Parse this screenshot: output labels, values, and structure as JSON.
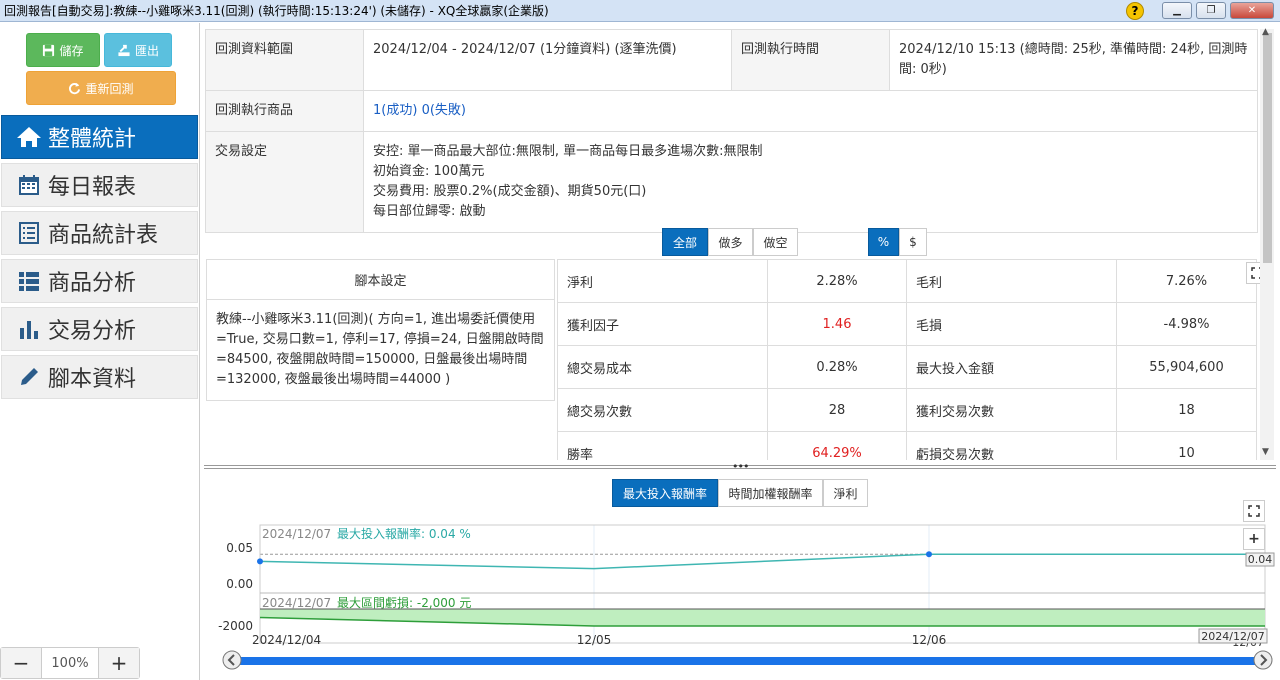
{
  "window": {
    "title": "回測報告[自動交易]:教練--小雞啄米3.11(回測) (執行時間:15:13:24') (未儲存) - XQ全球贏家(企業版)",
    "help": "?",
    "min": "▁",
    "restore": "❐",
    "close": "✕"
  },
  "sidebar": {
    "save_label": "儲存",
    "export_label": "匯出",
    "rerun_label": "重新回測",
    "items": [
      {
        "label": "整體統計",
        "icon": "home-icon"
      },
      {
        "label": "每日報表",
        "icon": "calendar-icon"
      },
      {
        "label": "商品統計表",
        "icon": "list-icon"
      },
      {
        "label": "商品分析",
        "icon": "list-bullet-icon"
      },
      {
        "label": "交易分析",
        "icon": "bar-chart-icon"
      },
      {
        "label": "腳本資料",
        "icon": "pencil-icon"
      }
    ],
    "zoom": {
      "minus": "−",
      "value": "100%",
      "plus": "+"
    }
  },
  "info": {
    "range_label": "回測資料範圍",
    "range_value": "2024/12/04 - 2024/12/07 (1分鐘資料) (逐筆洗價)",
    "exec_label": "回測執行時間",
    "exec_value": "2024/12/10 15:13 (總時間: 25秒, 準備時間: 24秒, 回測時間: 0秒)",
    "product_label": "回測執行商品",
    "product_success": "1(成功)",
    "product_fail": "0(失敗)",
    "trade_label": "交易設定",
    "trade_lines": [
      "安控: 單一商品最大部位:無限制, 單一商品每日最多進場次數:無限制",
      "初始資金: 100萬元",
      "交易費用: 股票0.2%(成交金額)、期貨50元(口)",
      "每日部位歸零: 啟動"
    ]
  },
  "filters": {
    "direction": [
      "全部",
      "做多",
      "做空"
    ],
    "unit": [
      "%",
      "$"
    ]
  },
  "script": {
    "header": "腳本設定",
    "body": "教練--小雞啄米3.11(回測)( 方向=1, 進出場委託價使用=True, 交易口數=1, 停利=17, 停損=24, 日盤開啟時間=84500, 夜盤開啟時間=150000, 日盤最後出場時間=132000, 夜盤最後出場時間=44000 )"
  },
  "stats": [
    {
      "l1": "淨利",
      "v1": "2.28%",
      "l2": "毛利",
      "v2": "7.26%"
    },
    {
      "l1": "獲利因子",
      "v1": "1.46",
      "l2": "毛損",
      "v2": "-4.98%"
    },
    {
      "l1": "總交易成本",
      "v1": "0.28%",
      "l2": "最大投入金額",
      "v2": "55,904,600"
    },
    {
      "l1": "總交易次數",
      "v1": "28",
      "l2": "獲利交易次數",
      "v2": "18"
    },
    {
      "l1": "勝率",
      "v1": "64.29%",
      "l2": "虧損交易次數",
      "v2": "10"
    }
  ],
  "chart_tabs": [
    "最大投入報酬率",
    "時間加權報酬率",
    "淨利"
  ],
  "chart_data": {
    "type": "line",
    "x": [
      "2024/12/04",
      "2024/12/05",
      "2024/12/06",
      "2024/12/07"
    ],
    "series": [
      {
        "name": "最大投入報酬率",
        "values": [
          0.03,
          0.02,
          0.04,
          0.04
        ]
      },
      {
        "name": "最大區間虧損",
        "values": [
          -1000,
          -2000,
          -2000,
          -2000
        ]
      }
    ],
    "top_header_date": "2024/12/07",
    "top_header_label": "最大投入報酬率: 0.04 %",
    "bottom_header_date": "2024/12/07",
    "bottom_header_label": "最大區間虧損: -2,000 元",
    "top_ticks": [
      "0.05",
      "0.00"
    ],
    "bottom_ticks": [
      "-2000"
    ],
    "x_ticks": [
      "2024/12/04",
      "12/05",
      "12/06",
      "12/07"
    ],
    "end_value_label": "0.04",
    "end_date_label": "2024/12/07",
    "colors": {
      "line": "#3fb6b2",
      "area": "#bfeebf",
      "area_line": "#2e9e3a",
      "accent": "#1a73e8"
    }
  }
}
